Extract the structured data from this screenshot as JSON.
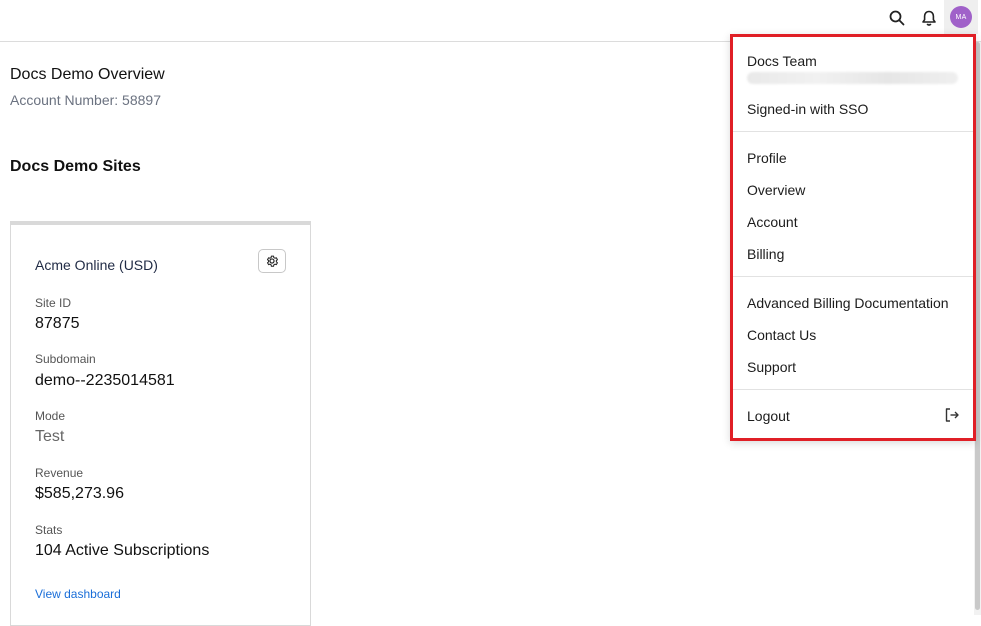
{
  "header": {
    "search_icon": "search-icon",
    "bell_icon": "bell-icon",
    "avatar_initials": "MA"
  },
  "overview": {
    "title": "Docs Demo Overview",
    "account_number": "Account Number: 58897"
  },
  "sites": {
    "title": "Docs Demo Sites",
    "card": {
      "name": "Acme Online (USD)",
      "fields": [
        {
          "label": "Site ID",
          "value": "87875"
        },
        {
          "label": "Subdomain",
          "value": "demo--2235014581"
        },
        {
          "label": "Mode",
          "value": "Test"
        },
        {
          "label": "Revenue",
          "value": "$585,273.96"
        },
        {
          "label": "Stats",
          "value": "104 Active Subscriptions"
        }
      ],
      "link": "View dashboard"
    }
  },
  "menu": {
    "user_name": "Docs Team",
    "sso_status": "Signed-in with SSO",
    "nav": [
      "Profile",
      "Overview",
      "Account",
      "Billing"
    ],
    "help": [
      "Advanced Billing Documentation",
      "Contact Us",
      "Support"
    ],
    "logout": "Logout"
  },
  "colors": {
    "highlight_border": "#e01f26",
    "avatar_bg": "#a061c9",
    "link": "#1a6ed8"
  }
}
